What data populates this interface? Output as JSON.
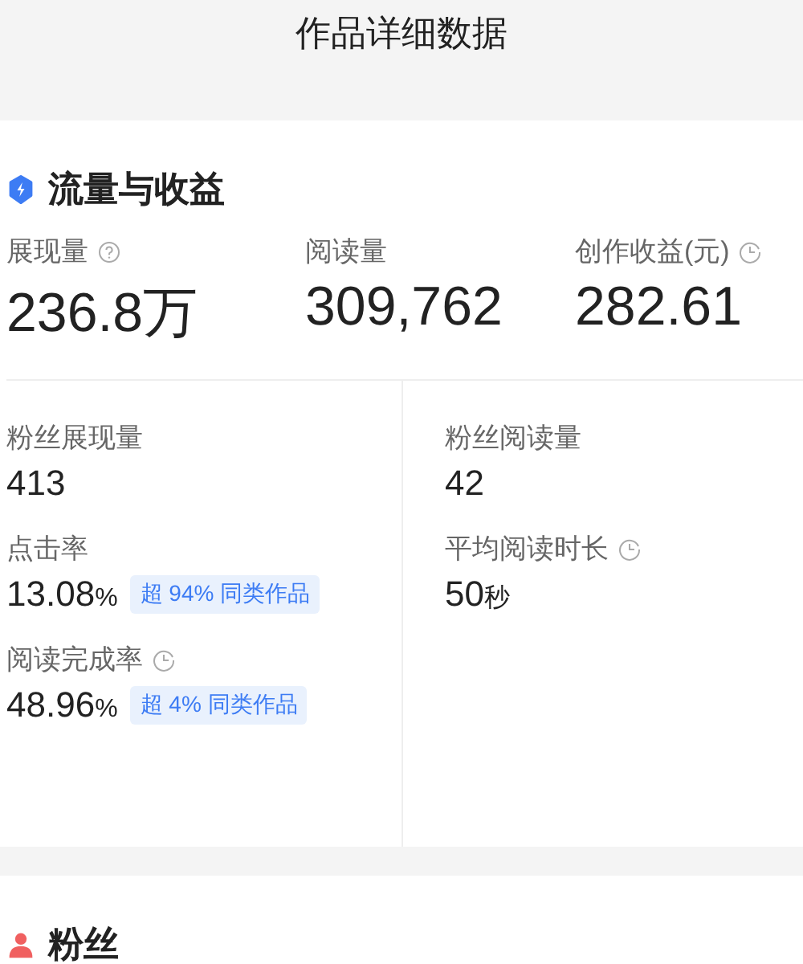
{
  "page_title": "作品详细数据",
  "sections": [
    {
      "title": "流量与收益",
      "top_metrics": [
        {
          "label": "展现量",
          "kind": "help",
          "value": "236.8万"
        },
        {
          "label": "阅读量",
          "value": "309,762"
        },
        {
          "label": "创作收益(元)",
          "kind": "clock",
          "value": "282.61"
        }
      ],
      "columns": [
        [
          {
            "label": "粉丝展现量",
            "value": "413"
          },
          {
            "label": "点击率",
            "value": "13.08",
            "unit": "%",
            "badge": "超 94% 同类作品"
          },
          {
            "label": "阅读完成率",
            "kind": "clock",
            "value": "48.96",
            "unit": "%",
            "badge": "超 4% 同类作品"
          }
        ],
        [
          {
            "label": "粉丝阅读量",
            "value": "42"
          },
          {
            "label": "平均阅读时长",
            "kind": "clock",
            "value": "50",
            "unit": "秒"
          }
        ]
      ]
    },
    {
      "title": "粉丝"
    }
  ]
}
